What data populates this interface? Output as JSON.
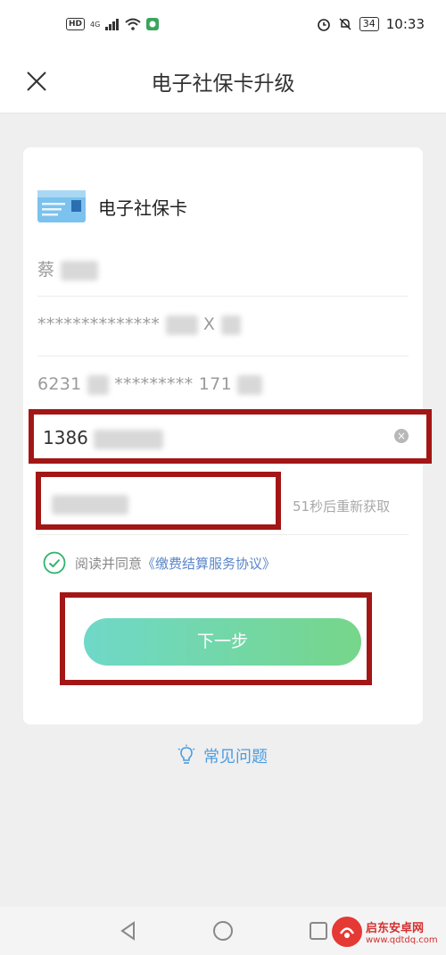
{
  "status_bar": {
    "hd_label": "HD",
    "network_label": "4G",
    "battery_level": "34",
    "time": "10:33"
  },
  "header": {
    "title": "电子社保卡升级"
  },
  "card": {
    "title": "电子社保卡",
    "name_visible": "蔡",
    "id_masked_prefix": "**************",
    "id_suffix_visible": "X",
    "bank_prefix": "6231",
    "bank_masked": "*********",
    "bank_suffix_visible": "171",
    "phone_prefix": "1386",
    "resend_label": "51秒后重新获取",
    "agree_text": "阅读并同意",
    "agreement_link": "《缴费结算服务协议》",
    "next_label": "下一步"
  },
  "faq": {
    "label": "常见问题"
  },
  "watermark": {
    "title": "启东安卓网",
    "url": "www.qdtdq.com"
  },
  "colors": {
    "accent_link": "#5a86c8",
    "faq_blue": "#4d9ce0",
    "highlight_red": "#a31616",
    "button_start": "#6fd8c8",
    "button_end": "#76d68a",
    "check_green": "#2db36b"
  }
}
